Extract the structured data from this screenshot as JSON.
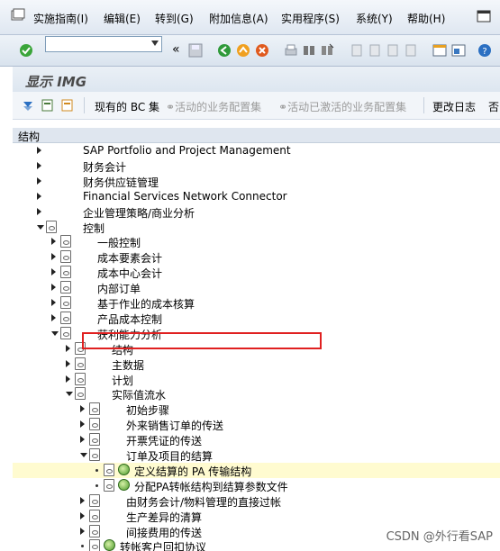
{
  "menu": [
    "实施指南(I)",
    "编辑(E)",
    "转到(G)",
    "附加信息(A)",
    "实用程序(S)",
    "系统(Y)",
    "帮助(H)"
  ],
  "title": "显示 IMG",
  "toolbar": {
    "bc_set": "现有的 BC 集",
    "activate_bc": "活动的业务配置集",
    "activated_bc": "活动已激活的业务配置集",
    "change_log": "更改日志",
    "cut_off": "否"
  },
  "tree_header": "结构",
  "tree": [
    {
      "label": "SAP Portfolio and Project Management",
      "level": 0,
      "arrow": "right",
      "icon": "none"
    },
    {
      "label": "财务会计",
      "level": 0,
      "arrow": "right",
      "icon": "none"
    },
    {
      "label": "财务供应链管理",
      "level": 0,
      "arrow": "right",
      "icon": "none"
    },
    {
      "label": "Financial Services Network Connector",
      "level": 0,
      "arrow": "right",
      "icon": "none"
    },
    {
      "label": "企业管理策略/商业分析",
      "level": 0,
      "arrow": "right",
      "icon": "none"
    },
    {
      "label": "控制",
      "level": 0,
      "arrow": "down",
      "icon": "doc"
    },
    {
      "label": "一般控制",
      "level": 1,
      "arrow": "right",
      "icon": "doc"
    },
    {
      "label": "成本要素会计",
      "level": 1,
      "arrow": "right",
      "icon": "doc"
    },
    {
      "label": "成本中心会计",
      "level": 1,
      "arrow": "right",
      "icon": "doc"
    },
    {
      "label": "内部订单",
      "level": 1,
      "arrow": "right",
      "icon": "doc"
    },
    {
      "label": "基于作业的成本核算",
      "level": 1,
      "arrow": "right",
      "icon": "doc"
    },
    {
      "label": "产品成本控制",
      "level": 1,
      "arrow": "right",
      "icon": "doc"
    },
    {
      "label": "获利能力分析",
      "level": 1,
      "arrow": "down",
      "icon": "doc"
    },
    {
      "label": "结构",
      "level": 2,
      "arrow": "right",
      "icon": "doc"
    },
    {
      "label": "主数据",
      "level": 2,
      "arrow": "right",
      "icon": "doc"
    },
    {
      "label": "计划",
      "level": 2,
      "arrow": "right",
      "icon": "doc"
    },
    {
      "label": "实际值流水",
      "level": 2,
      "arrow": "down",
      "icon": "doc"
    },
    {
      "label": "初始步骤",
      "level": 3,
      "arrow": "right",
      "icon": "doc"
    },
    {
      "label": "外来销售订单的传送",
      "level": 3,
      "arrow": "right",
      "icon": "doc"
    },
    {
      "label": "开票凭证的传送",
      "level": 3,
      "arrow": "right",
      "icon": "doc"
    },
    {
      "label": "订单及项目的结算",
      "level": 3,
      "arrow": "down",
      "icon": "doc"
    },
    {
      "label": "定义结算的 PA 传输结构",
      "level": 4,
      "arrow": "bullet",
      "icon": "doc+clock",
      "selected": true
    },
    {
      "label": "分配PA转帐结构到结算参数文件",
      "level": 4,
      "arrow": "bullet",
      "icon": "doc+clock"
    },
    {
      "label": "由财务会计/物料管理的直接过帐",
      "level": 3,
      "arrow": "right",
      "icon": "doc"
    },
    {
      "label": "生产差异的清算",
      "level": 3,
      "arrow": "right",
      "icon": "doc"
    },
    {
      "label": "间接费用的传送",
      "level": 3,
      "arrow": "right",
      "icon": "doc"
    },
    {
      "label": "转帐客户回扣协议",
      "level": 3,
      "arrow": "bullet",
      "icon": "doc+clock"
    }
  ],
  "watermark": "CSDN @外行看SAP"
}
